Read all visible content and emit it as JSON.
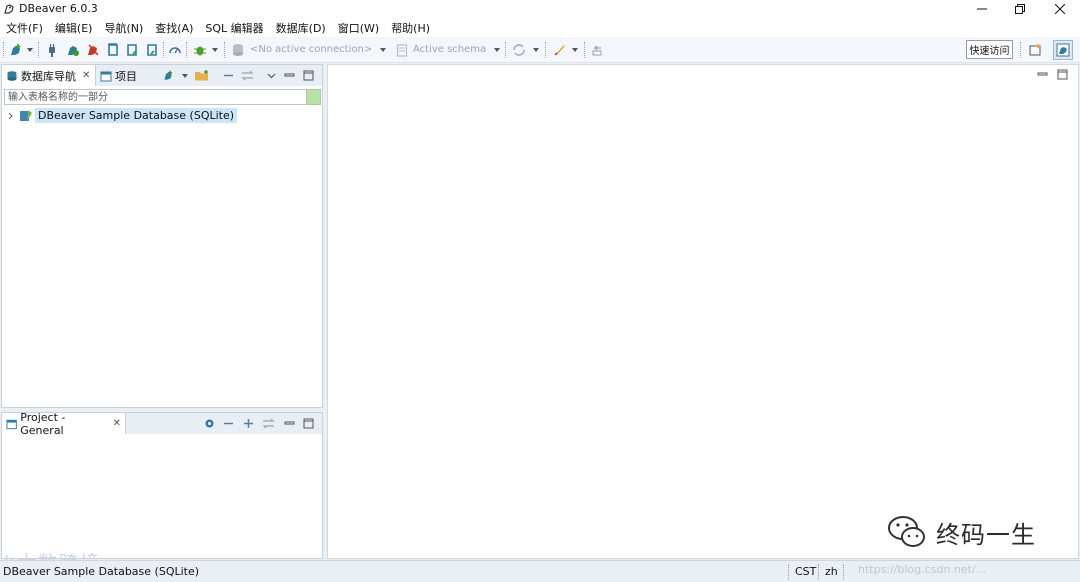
{
  "window": {
    "title": "DBeaver 6.0.3",
    "controls": {
      "minimize": "minimize",
      "restore": "restore",
      "close": "close"
    }
  },
  "menubar": {
    "items": [
      "文件(F)",
      "编辑(E)",
      "导航(N)",
      "查找(A)",
      "SQL 编辑器",
      "数据库(D)",
      "窗口(W)",
      "帮助(H)"
    ]
  },
  "toolbar": {
    "connection_selector": "<No active connection>",
    "schema_selector": "Active schema",
    "quick_access": "快速访问"
  },
  "navigator": {
    "tabs": [
      {
        "label": "数据库导航",
        "icon": "database-navigator-icon",
        "close": "✕"
      },
      {
        "label": "项目",
        "icon": "projects-icon"
      }
    ],
    "filter_placeholder": "输入表格名称的一部分",
    "tree": [
      {
        "label": "DBeaver Sample Database (SQLite)",
        "icon": "sqlite-database-icon",
        "expanded": false,
        "selected": true
      }
    ]
  },
  "project_panel": {
    "tab": {
      "label": "Project - General",
      "icon": "project-icon",
      "close": "✕"
    }
  },
  "statusbar": {
    "selection": "DBeaver Sample Database (SQLite)",
    "timezone": "CST",
    "locale": "zh"
  },
  "watermarks": {
    "wechat_account": "终码一生",
    "left_mark": "k大数跨境",
    "right_mark": "https://blog.csdn.net/..."
  },
  "colors": {
    "selection": "#cce4f7",
    "filter_green": "#b8e0a8",
    "workbench_bg": "#eaeff5",
    "panel_border": "#c8d0da"
  }
}
